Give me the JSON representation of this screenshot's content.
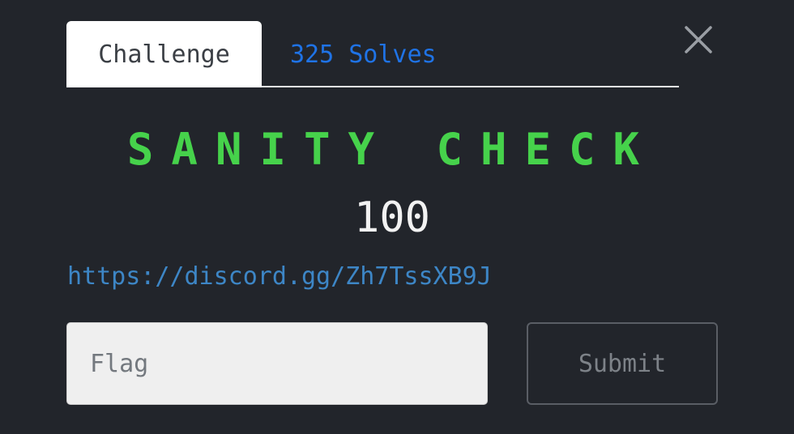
{
  "tabs": {
    "challenge_label": "Challenge",
    "solves_label": "325 Solves"
  },
  "challenge": {
    "name": "SANITY CHECK",
    "points": "100",
    "link": "https://discord.gg/Zh7TssXB9J"
  },
  "form": {
    "flag_placeholder": "Flag",
    "submit_label": "Submit"
  },
  "colors": {
    "background": "#22252b",
    "title": "#46d24b",
    "link": "#3d86c6",
    "tab_link": "#1f73e6"
  },
  "icons": {
    "close": "close-icon"
  }
}
